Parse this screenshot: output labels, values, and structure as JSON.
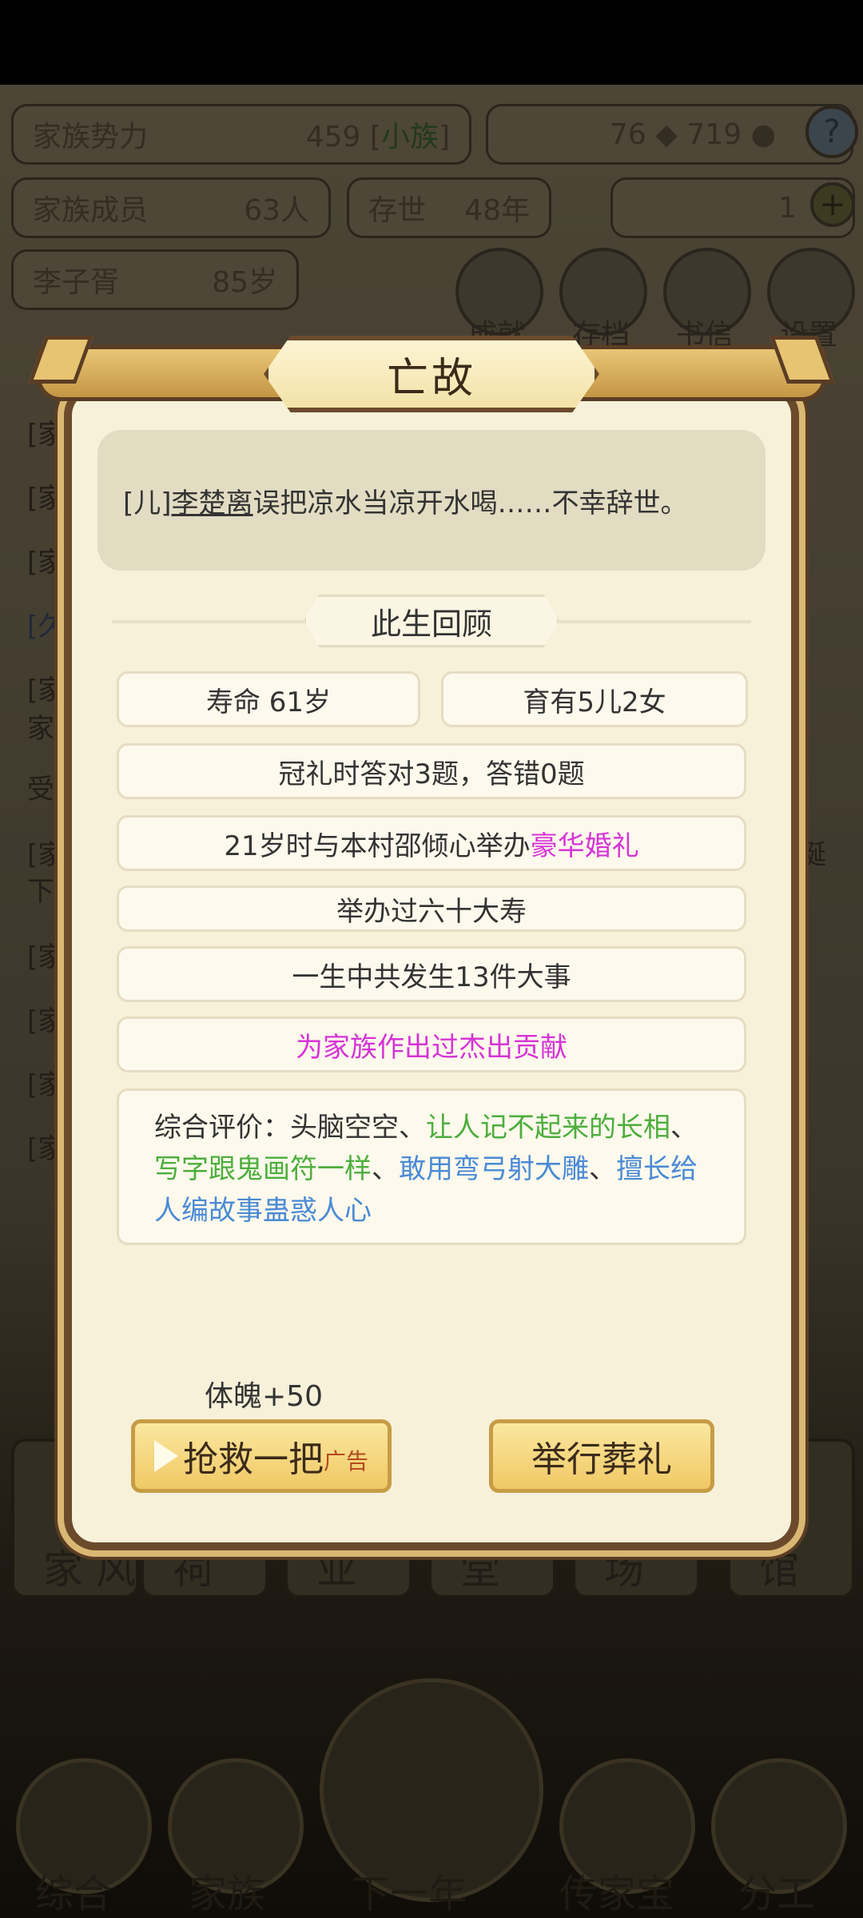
{
  "background": {
    "power_label": "家族势力",
    "power_value": "459",
    "power_bracket_open": "[",
    "power_rank": "小族",
    "power_bracket_close": "]",
    "currency1": "76",
    "currency2": "719",
    "help_icon_text": "?",
    "members_label": "家族成员",
    "members_value": "63人",
    "exist_label": "存世",
    "exist_value": "48年",
    "gold_value": "1",
    "plus_icon_text": "+",
    "head_name": "李子胥",
    "head_age": "85岁",
    "top_buttons": [
      "成就",
      "存档",
      "书信",
      "设置"
    ],
    "side_fragments": [
      "[家",
      "[家",
      "[家",
      "[久",
      "[家",
      "家",
      "受",
      "[家",
      "下",
      "[家",
      "[家",
      "[家",
      "[家"
    ],
    "right_fragment": "诞",
    "tabs": [
      "家\n风",
      "祠",
      "业",
      "堂",
      "场",
      "馆"
    ],
    "nav": [
      "综合",
      "家族",
      "下一年",
      "传家宝",
      "分工"
    ]
  },
  "dialog": {
    "title": "亡故",
    "message": {
      "prefix": "[儿]",
      "name": "李楚离",
      "text": "误把凉水当凉开水喝……不幸辞世。"
    },
    "section_title": "此生回顾",
    "lifespan": "寿命 61岁",
    "children": "育有5儿2女",
    "coming_of_age": "冠礼时答对3题，答错0题",
    "wedding_prefix": "21岁时与本村邵倾心举办",
    "wedding_highlight": "豪华婚礼",
    "birthday": "举办过六十大寿",
    "events": "一生中共发生13件大事",
    "contribution": "为家族作出过杰出贡献",
    "evaluation": {
      "label": "综合评价：",
      "t1": "头脑空空、",
      "t2": "让人记不起来的长相",
      "t3": "、",
      "t4": "写字跟鬼画符一样",
      "t5": "、",
      "t6": "敢用弯弓射大雕",
      "t7": "、",
      "t8": "擅长给人编故事蛊惑人心"
    },
    "reward": "体魄+50",
    "rescue_button": "抢救一把",
    "ad_tag": "广告",
    "funeral_button": "举行葬礼"
  },
  "colors": {
    "highlight_magenta": "#d634d6",
    "trait_green": "#4cae3c",
    "trait_blue": "#4a8ad6",
    "button_gold": "#f0c964"
  }
}
